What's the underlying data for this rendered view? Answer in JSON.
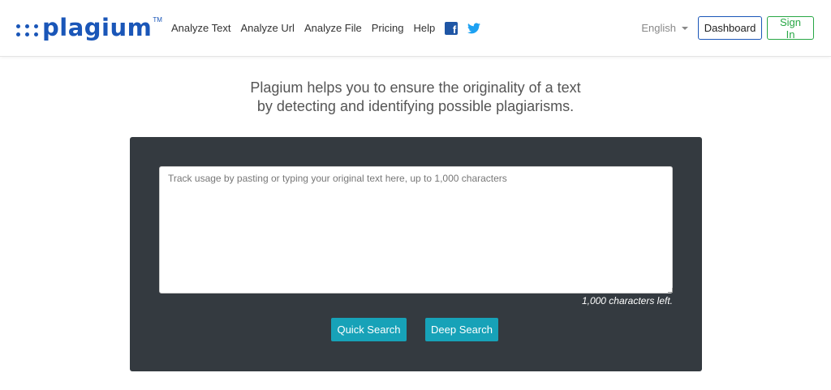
{
  "brand": {
    "name": "plagium",
    "trademark": "TM",
    "color": "#1a56b8"
  },
  "nav": {
    "links": [
      "Analyze Text",
      "Analyze Url",
      "Analyze File",
      "Pricing",
      "Help"
    ],
    "social": [
      {
        "icon": "facebook-icon",
        "color": "#1f56a5"
      },
      {
        "icon": "twitter-icon",
        "color": "#1da1f2"
      }
    ],
    "language": "English",
    "dashboard_label": "Dashboard",
    "signin_label": "Sign In"
  },
  "tagline": {
    "line1": "Plagium helps you to ensure the originality of a text",
    "line2": "by detecting and identifying possible plagiarisms."
  },
  "search": {
    "placeholder": "Track usage by pasting or typing your original text here, up to 1,000 characters",
    "value": "",
    "chars_left": "1,000 characters left.",
    "quick_label": "Quick Search",
    "deep_label": "Deep Search"
  },
  "colors": {
    "panel": "#343a40",
    "primary_button": "#17a2b8",
    "signin_green": "#28a745"
  }
}
